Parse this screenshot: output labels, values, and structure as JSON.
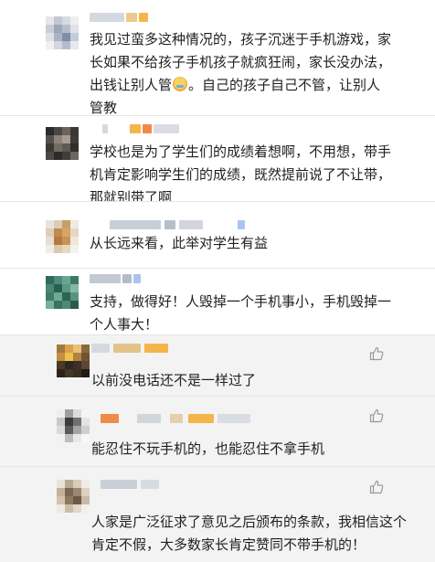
{
  "comments": [
    {
      "lines": [
        "我见过蛮多这种情况的，孩子沉迷于手机游戏，家",
        "长如果不给孩子手机孩子就疯狂闹，家长没办法，",
        "出钱让别人管",
        "。自己的孩子自己不管，让别人",
        "管教"
      ],
      "emoji": "sweat-smile-emoji"
    },
    {
      "lines": [
        "学校也是为了学生们的成绩着想啊，不用想，带手",
        "机肯定影响学生们的成绩，既然提前说了不让带，",
        "那就别带了啊"
      ]
    },
    {
      "lines": [
        "从长远来看，此举对学生有益"
      ]
    },
    {
      "lines": [
        "支持，做得好！人毁掉一个手机事小，手机毁掉一",
        "个人事大！"
      ]
    },
    {
      "lines": [
        "以前没电话还不是一样过了"
      ],
      "like_icon": "thumbs-up-icon"
    },
    {
      "lines": [
        "能忍住不玩手机的，也能忍住不拿手机"
      ],
      "like_icon": "thumbs-up-icon"
    },
    {
      "lines": [
        "人家是广泛征求了意见之后颁布的条款，我相信这个",
        "肯定不假，大多数家长肯定赞同不带手机的！"
      ],
      "like_icon": "thumbs-up-icon"
    }
  ],
  "colors": {
    "reply_background": "#f3f3f3",
    "text": "#1f1f1f",
    "blur_gray": "#c9cfd9",
    "blur_orange": "#f5b54a",
    "blur_blue": "#a9c4f0",
    "like_icon": "#9a9a9a"
  }
}
